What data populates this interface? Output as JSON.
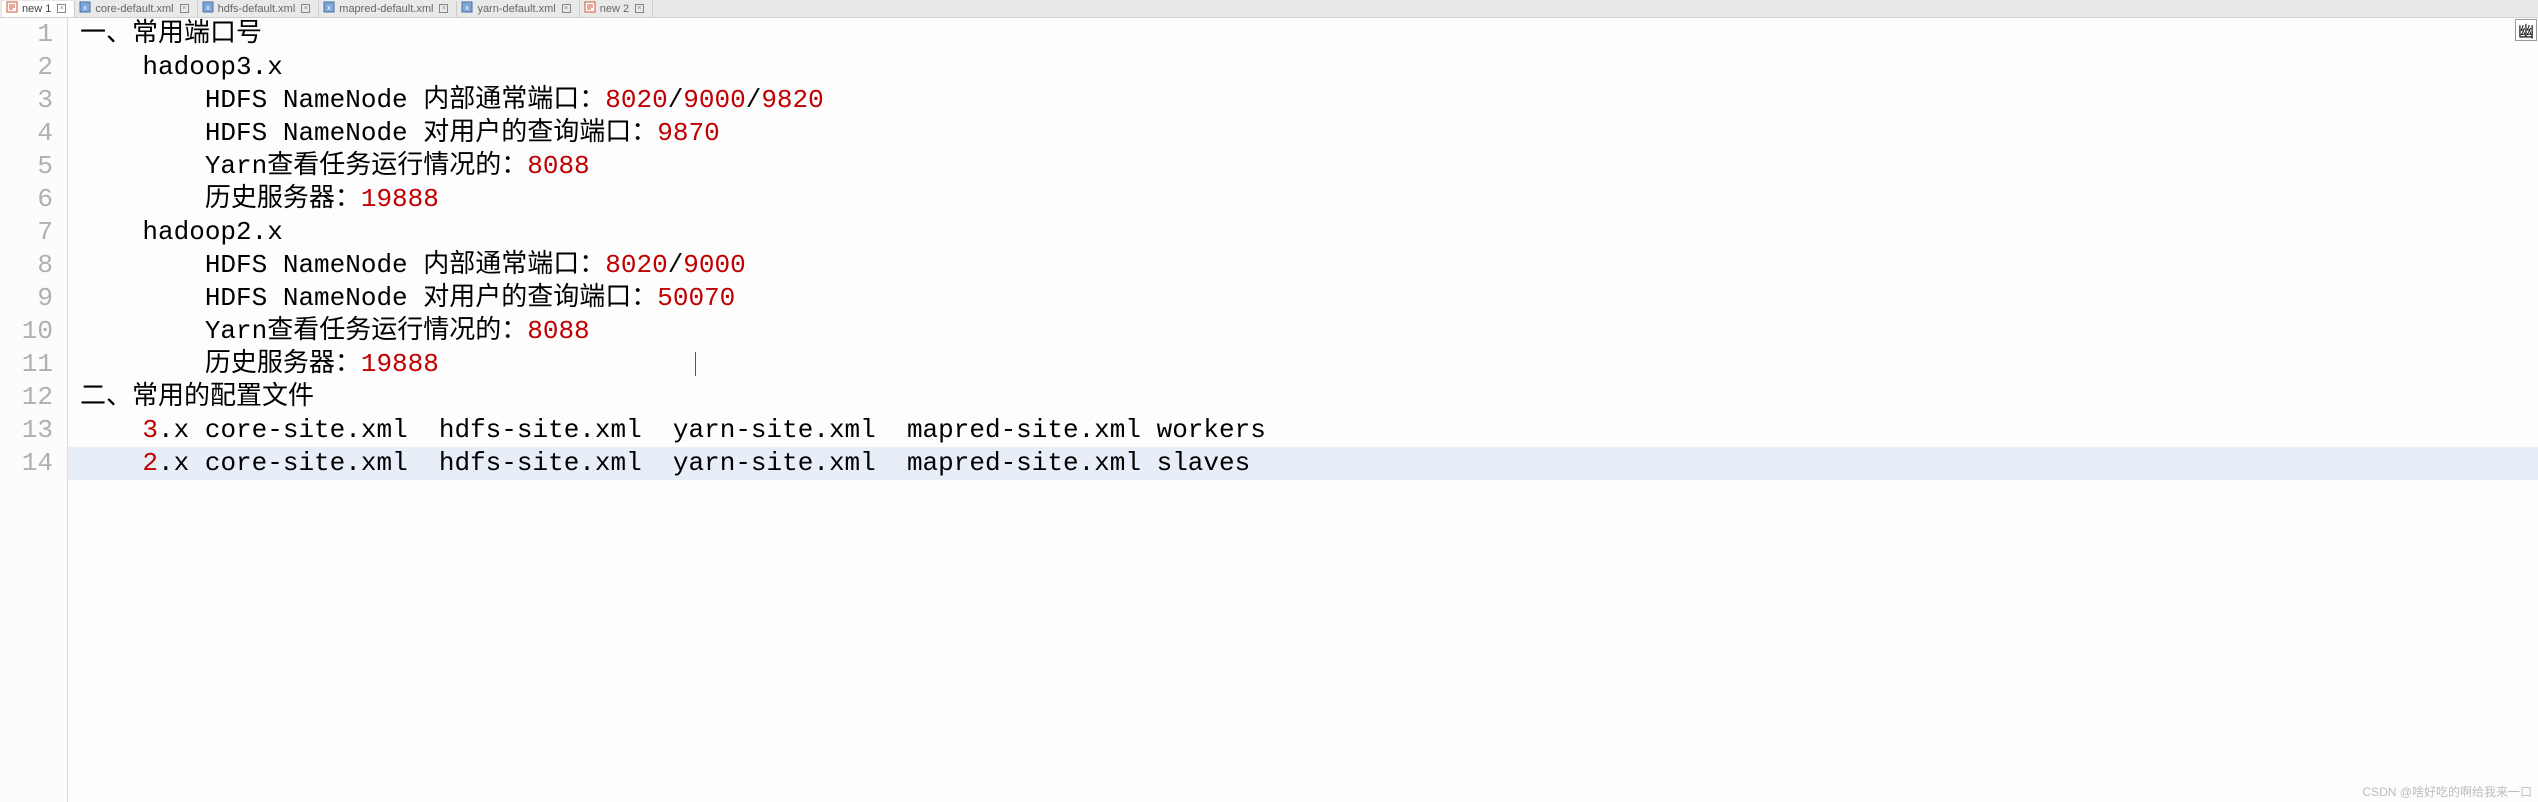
{
  "tabs": [
    {
      "label": "new 1",
      "icon": "text",
      "active": true
    },
    {
      "label": "core-default.xml",
      "icon": "xml",
      "active": false
    },
    {
      "label": "hdfs-default.xml",
      "icon": "xml",
      "active": false
    },
    {
      "label": "mapred-default.xml",
      "icon": "xml",
      "active": false
    },
    {
      "label": "yarn-default.xml",
      "icon": "xml",
      "active": false
    },
    {
      "label": "new 2",
      "icon": "text",
      "active": false
    }
  ],
  "corner_glyph": "幽",
  "watermark": "CSDN @啥好吃的啊给我来一口",
  "lines": [
    {
      "n": 1,
      "segments": [
        {
          "t": "一、常用端口号",
          "c": "k"
        }
      ],
      "indent": 0
    },
    {
      "n": 2,
      "segments": [
        {
          "t": "hadoop3.x",
          "c": "k"
        }
      ],
      "indent": 1
    },
    {
      "n": 3,
      "segments": [
        {
          "t": "HDFS NameNode 内部通常端口：",
          "c": "k"
        },
        {
          "t": "8020",
          "c": "r"
        },
        {
          "t": "/",
          "c": "k"
        },
        {
          "t": "9000",
          "c": "r"
        },
        {
          "t": "/",
          "c": "k"
        },
        {
          "t": "9820",
          "c": "r"
        }
      ],
      "indent": 2
    },
    {
      "n": 4,
      "segments": [
        {
          "t": "HDFS NameNode 对用户的查询端口：",
          "c": "k"
        },
        {
          "t": "9870",
          "c": "r"
        }
      ],
      "indent": 2
    },
    {
      "n": 5,
      "segments": [
        {
          "t": "Yarn查看任务运行情况的：",
          "c": "k"
        },
        {
          "t": "8088",
          "c": "r"
        }
      ],
      "indent": 2
    },
    {
      "n": 6,
      "segments": [
        {
          "t": "历史服务器：",
          "c": "k"
        },
        {
          "t": "19888",
          "c": "r"
        }
      ],
      "indent": 2
    },
    {
      "n": 7,
      "segments": [
        {
          "t": "hadoop2.x",
          "c": "k"
        }
      ],
      "indent": 1
    },
    {
      "n": 8,
      "segments": [
        {
          "t": "HDFS NameNode 内部通常端口：",
          "c": "k"
        },
        {
          "t": "8020",
          "c": "r"
        },
        {
          "t": "/",
          "c": "k"
        },
        {
          "t": "9000",
          "c": "r"
        }
      ],
      "indent": 2
    },
    {
      "n": 9,
      "segments": [
        {
          "t": "HDFS NameNode 对用户的查询端口：",
          "c": "k"
        },
        {
          "t": "50070",
          "c": "r"
        }
      ],
      "indent": 2
    },
    {
      "n": 10,
      "segments": [
        {
          "t": "Yarn查看任务运行情况的：",
          "c": "k"
        },
        {
          "t": "8088",
          "c": "r"
        }
      ],
      "indent": 2
    },
    {
      "n": 11,
      "segments": [
        {
          "t": "历史服务器：",
          "c": "k"
        },
        {
          "t": "19888",
          "c": "r"
        }
      ],
      "indent": 2,
      "caret": true
    },
    {
      "n": 12,
      "segments": [
        {
          "t": "二、常用的配置文件",
          "c": "k"
        }
      ],
      "indent": 0
    },
    {
      "n": 13,
      "segments": [
        {
          "t": "3",
          "c": "r"
        },
        {
          "t": ".x core-site.xml  hdfs-site.xml  yarn-site.xml  mapred-site.xml workers",
          "c": "k"
        }
      ],
      "indent": 1
    },
    {
      "n": 14,
      "segments": [
        {
          "t": "2",
          "c": "r"
        },
        {
          "t": ".x core-site.xml  hdfs-site.xml  yarn-site.xml  mapred-site.xml slaves",
          "c": "k"
        }
      ],
      "indent": 1,
      "highlight": true
    }
  ]
}
